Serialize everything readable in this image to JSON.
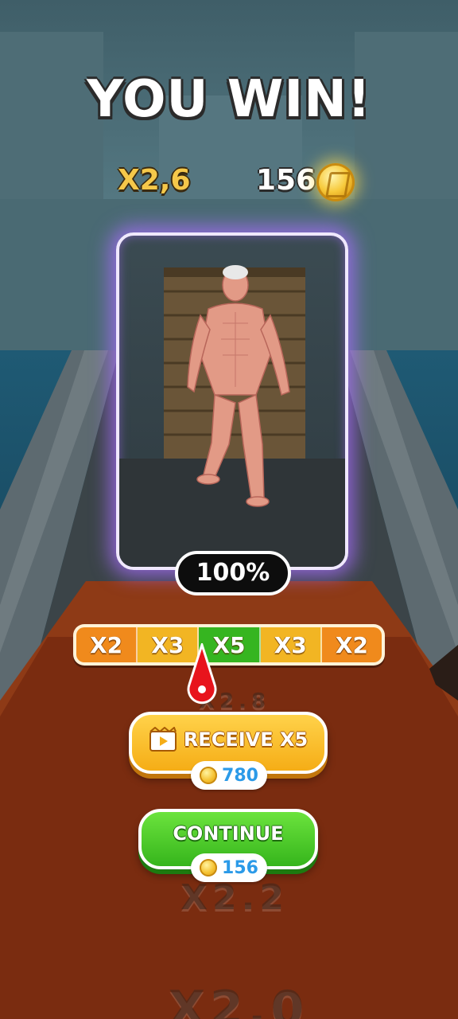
{
  "result": {
    "title": "YOU WIN!",
    "multiplier": "X2,6",
    "coins": "156"
  },
  "character_card": {
    "progress_label": "100%",
    "progress_percent": 100
  },
  "multiplier_bar": {
    "segments": [
      {
        "label": "X2",
        "color": "#f08a1c"
      },
      {
        "label": "X3",
        "color": "#f2b523"
      },
      {
        "label": "X5",
        "color": "#36b520"
      },
      {
        "label": "X3",
        "color": "#f2b523"
      },
      {
        "label": "X2",
        "color": "#f08a1c"
      }
    ],
    "selected_index": 2
  },
  "buttons": {
    "receive_label": "RECEIVE X5",
    "receive_reward": "780",
    "continue_label": "CONTINUE",
    "continue_reward": "156"
  },
  "track_markers": {
    "marker_a": "X2.8",
    "marker_b": "X2.2",
    "marker_c": "X2.0"
  },
  "colors": {
    "card_glow": "#aa6eff",
    "receive_button": "#f5ad16",
    "continue_button": "#36b51c",
    "reward_text": "#2b9ae8",
    "multiplier_text": "#f5c84a"
  }
}
